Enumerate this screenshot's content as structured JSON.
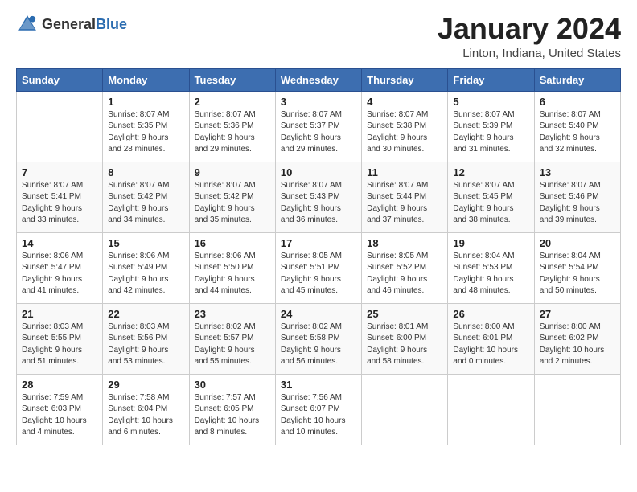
{
  "logo": {
    "general": "General",
    "blue": "Blue"
  },
  "header": {
    "title": "January 2024",
    "subtitle": "Linton, Indiana, United States"
  },
  "weekdays": [
    "Sunday",
    "Monday",
    "Tuesday",
    "Wednesday",
    "Thursday",
    "Friday",
    "Saturday"
  ],
  "weeks": [
    [
      {
        "day": "",
        "info": ""
      },
      {
        "day": "1",
        "info": "Sunrise: 8:07 AM\nSunset: 5:35 PM\nDaylight: 9 hours\nand 28 minutes."
      },
      {
        "day": "2",
        "info": "Sunrise: 8:07 AM\nSunset: 5:36 PM\nDaylight: 9 hours\nand 29 minutes."
      },
      {
        "day": "3",
        "info": "Sunrise: 8:07 AM\nSunset: 5:37 PM\nDaylight: 9 hours\nand 29 minutes."
      },
      {
        "day": "4",
        "info": "Sunrise: 8:07 AM\nSunset: 5:38 PM\nDaylight: 9 hours\nand 30 minutes."
      },
      {
        "day": "5",
        "info": "Sunrise: 8:07 AM\nSunset: 5:39 PM\nDaylight: 9 hours\nand 31 minutes."
      },
      {
        "day": "6",
        "info": "Sunrise: 8:07 AM\nSunset: 5:40 PM\nDaylight: 9 hours\nand 32 minutes."
      }
    ],
    [
      {
        "day": "7",
        "info": "Sunrise: 8:07 AM\nSunset: 5:41 PM\nDaylight: 9 hours\nand 33 minutes."
      },
      {
        "day": "8",
        "info": "Sunrise: 8:07 AM\nSunset: 5:42 PM\nDaylight: 9 hours\nand 34 minutes."
      },
      {
        "day": "9",
        "info": "Sunrise: 8:07 AM\nSunset: 5:42 PM\nDaylight: 9 hours\nand 35 minutes."
      },
      {
        "day": "10",
        "info": "Sunrise: 8:07 AM\nSunset: 5:43 PM\nDaylight: 9 hours\nand 36 minutes."
      },
      {
        "day": "11",
        "info": "Sunrise: 8:07 AM\nSunset: 5:44 PM\nDaylight: 9 hours\nand 37 minutes."
      },
      {
        "day": "12",
        "info": "Sunrise: 8:07 AM\nSunset: 5:45 PM\nDaylight: 9 hours\nand 38 minutes."
      },
      {
        "day": "13",
        "info": "Sunrise: 8:07 AM\nSunset: 5:46 PM\nDaylight: 9 hours\nand 39 minutes."
      }
    ],
    [
      {
        "day": "14",
        "info": "Sunrise: 8:06 AM\nSunset: 5:47 PM\nDaylight: 9 hours\nand 41 minutes."
      },
      {
        "day": "15",
        "info": "Sunrise: 8:06 AM\nSunset: 5:49 PM\nDaylight: 9 hours\nand 42 minutes."
      },
      {
        "day": "16",
        "info": "Sunrise: 8:06 AM\nSunset: 5:50 PM\nDaylight: 9 hours\nand 44 minutes."
      },
      {
        "day": "17",
        "info": "Sunrise: 8:05 AM\nSunset: 5:51 PM\nDaylight: 9 hours\nand 45 minutes."
      },
      {
        "day": "18",
        "info": "Sunrise: 8:05 AM\nSunset: 5:52 PM\nDaylight: 9 hours\nand 46 minutes."
      },
      {
        "day": "19",
        "info": "Sunrise: 8:04 AM\nSunset: 5:53 PM\nDaylight: 9 hours\nand 48 minutes."
      },
      {
        "day": "20",
        "info": "Sunrise: 8:04 AM\nSunset: 5:54 PM\nDaylight: 9 hours\nand 50 minutes."
      }
    ],
    [
      {
        "day": "21",
        "info": "Sunrise: 8:03 AM\nSunset: 5:55 PM\nDaylight: 9 hours\nand 51 minutes."
      },
      {
        "day": "22",
        "info": "Sunrise: 8:03 AM\nSunset: 5:56 PM\nDaylight: 9 hours\nand 53 minutes."
      },
      {
        "day": "23",
        "info": "Sunrise: 8:02 AM\nSunset: 5:57 PM\nDaylight: 9 hours\nand 55 minutes."
      },
      {
        "day": "24",
        "info": "Sunrise: 8:02 AM\nSunset: 5:58 PM\nDaylight: 9 hours\nand 56 minutes."
      },
      {
        "day": "25",
        "info": "Sunrise: 8:01 AM\nSunset: 6:00 PM\nDaylight: 9 hours\nand 58 minutes."
      },
      {
        "day": "26",
        "info": "Sunrise: 8:00 AM\nSunset: 6:01 PM\nDaylight: 10 hours\nand 0 minutes."
      },
      {
        "day": "27",
        "info": "Sunrise: 8:00 AM\nSunset: 6:02 PM\nDaylight: 10 hours\nand 2 minutes."
      }
    ],
    [
      {
        "day": "28",
        "info": "Sunrise: 7:59 AM\nSunset: 6:03 PM\nDaylight: 10 hours\nand 4 minutes."
      },
      {
        "day": "29",
        "info": "Sunrise: 7:58 AM\nSunset: 6:04 PM\nDaylight: 10 hours\nand 6 minutes."
      },
      {
        "day": "30",
        "info": "Sunrise: 7:57 AM\nSunset: 6:05 PM\nDaylight: 10 hours\nand 8 minutes."
      },
      {
        "day": "31",
        "info": "Sunrise: 7:56 AM\nSunset: 6:07 PM\nDaylight: 10 hours\nand 10 minutes."
      },
      {
        "day": "",
        "info": ""
      },
      {
        "day": "",
        "info": ""
      },
      {
        "day": "",
        "info": ""
      }
    ]
  ]
}
